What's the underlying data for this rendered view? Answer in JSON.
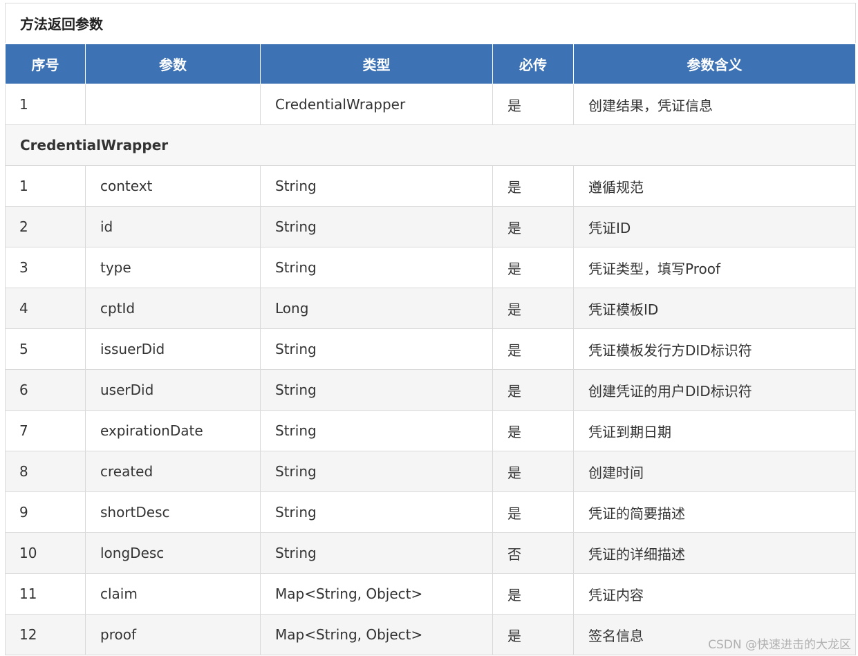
{
  "table": {
    "caption": "方法返回参数",
    "headers": [
      "序号",
      "参数",
      "类型",
      "必传",
      "参数含义"
    ],
    "top_rows": [
      {
        "index": "1",
        "param": "",
        "type": "CredentialWrapper",
        "required": "是",
        "description": "创建结果，凭证信息"
      }
    ],
    "section_title": "CredentialWrapper",
    "rows": [
      {
        "index": "1",
        "param": "context",
        "type": "String",
        "required": "是",
        "description": "遵循规范"
      },
      {
        "index": "2",
        "param": "id",
        "type": "String",
        "required": "是",
        "description": "凭证ID"
      },
      {
        "index": "3",
        "param": "type",
        "type": "String",
        "required": "是",
        "description": "凭证类型，填写Proof"
      },
      {
        "index": "4",
        "param": "cptId",
        "type": "Long",
        "required": "是",
        "description": "凭证模板ID"
      },
      {
        "index": "5",
        "param": "issuerDid",
        "type": "String",
        "required": "是",
        "description": "凭证模板发行方DID标识符"
      },
      {
        "index": "6",
        "param": "userDid",
        "type": "String",
        "required": "是",
        "description": "创建凭证的用户DID标识符"
      },
      {
        "index": "7",
        "param": "expirationDate",
        "type": "String",
        "required": "是",
        "description": "凭证到期日期"
      },
      {
        "index": "8",
        "param": "created",
        "type": "String",
        "required": "是",
        "description": "创建时间"
      },
      {
        "index": "9",
        "param": "shortDesc",
        "type": "String",
        "required": "是",
        "description": "凭证的简要描述"
      },
      {
        "index": "10",
        "param": "longDesc",
        "type": "String",
        "required": "否",
        "description": "凭证的详细描述"
      },
      {
        "index": "11",
        "param": "claim",
        "type": "Map<String, Object>",
        "required": "是",
        "description": "凭证内容"
      },
      {
        "index": "12",
        "param": "proof",
        "type": "Map<String, Object>",
        "required": "是",
        "description": "签名信息"
      }
    ]
  },
  "watermark": "CSDN @快速进击的大龙区",
  "colors": {
    "header_bg": "#3d72b4",
    "header_text": "#ffffff",
    "row_alt_bg": "#f5f5f5",
    "border": "#d9d9d9"
  }
}
